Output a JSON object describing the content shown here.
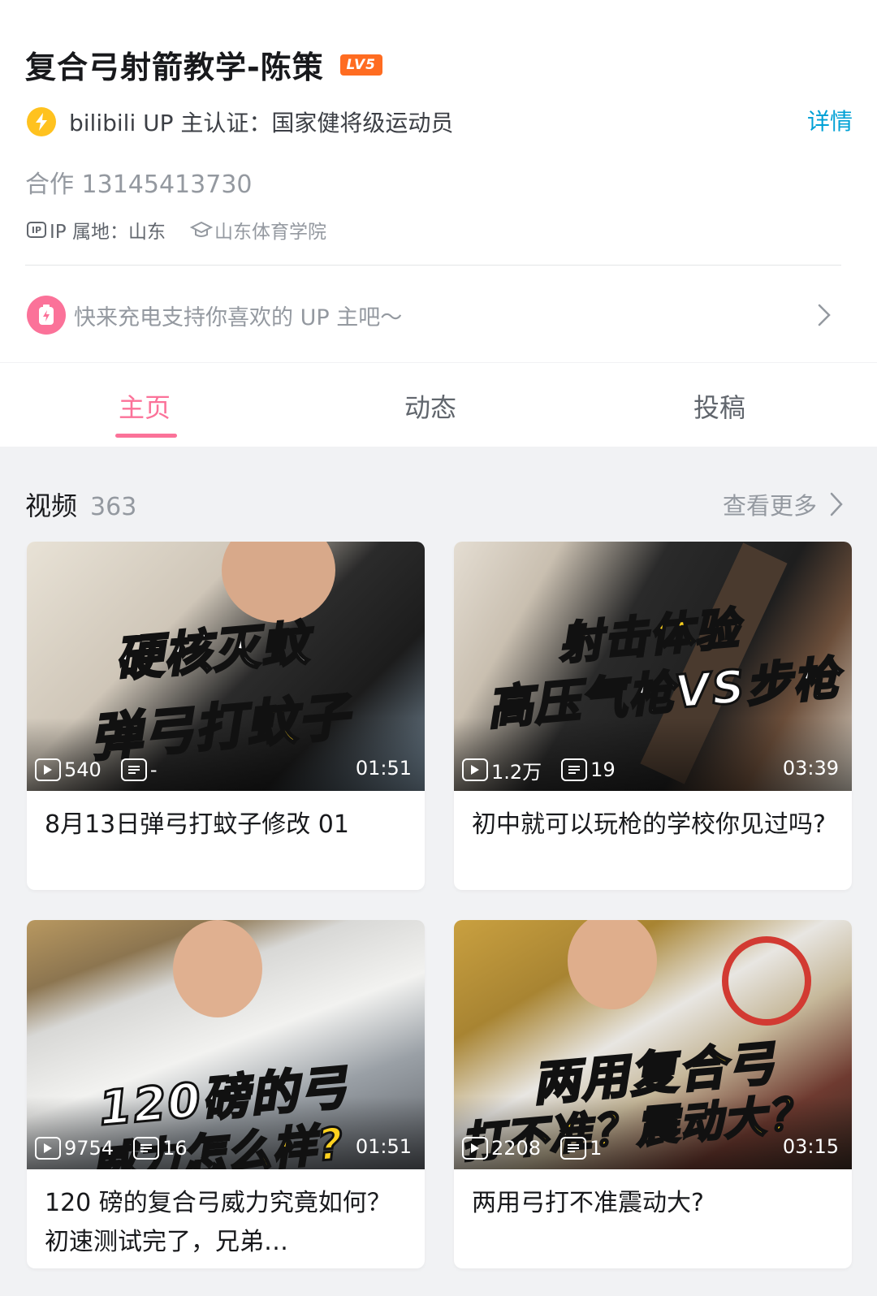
{
  "profile": {
    "name": "复合弓射箭教学-陈策",
    "level_badge": "LV5",
    "verify_text": "bilibili UP 主认证：国家健将级运动员",
    "detail_link": "详情",
    "cooperation": "合作 13145413730",
    "ip_location": "IP 属地：山东",
    "school": "山东体育学院",
    "charge_prompt": "快来充电支持你喜欢的 UP 主吧～"
  },
  "tabs": [
    {
      "label": "主页",
      "active": true
    },
    {
      "label": "动态",
      "active": false
    },
    {
      "label": "投稿",
      "active": false
    }
  ],
  "videos_section": {
    "title": "视频",
    "count": "363",
    "more_label": "查看更多"
  },
  "videos": [
    {
      "overlay_lines": [
        "硬核灭蚊",
        "弹弓打蚊子"
      ],
      "views": "540",
      "danmaku": "-",
      "duration": "01:51",
      "title": "8月13日弹弓打蚊子修改 01"
    },
    {
      "overlay_lines": [
        "射击体验",
        "高压气枪VS步枪"
      ],
      "views": "1.2万",
      "danmaku": "19",
      "duration": "03:39",
      "title": "初中就可以玩枪的学校你见过吗?"
    },
    {
      "overlay_lines": [
        "120磅的弓",
        "威力怎么样?"
      ],
      "views": "9754",
      "danmaku": "16",
      "duration": "01:51",
      "title": "120 磅的复合弓威力究竟如何？初速测试完了，兄弟…"
    },
    {
      "overlay_lines": [
        "两用复合弓",
        "打不准？震动大？"
      ],
      "views": "2208",
      "danmaku": "1",
      "duration": "03:15",
      "title": "两用弓打不准震动大?"
    }
  ],
  "colors": {
    "accent_pink": "#fb7299",
    "link_blue": "#00a1d6",
    "level_orange": "#ff6c21",
    "verify_yellow": "#ffc21f"
  },
  "icons": {
    "verify": "lightning-icon",
    "ip": "ip-icon",
    "school": "graduation-cap-icon",
    "charge": "battery-bolt-icon",
    "play": "play-icon",
    "danmaku": "danmaku-icon"
  }
}
